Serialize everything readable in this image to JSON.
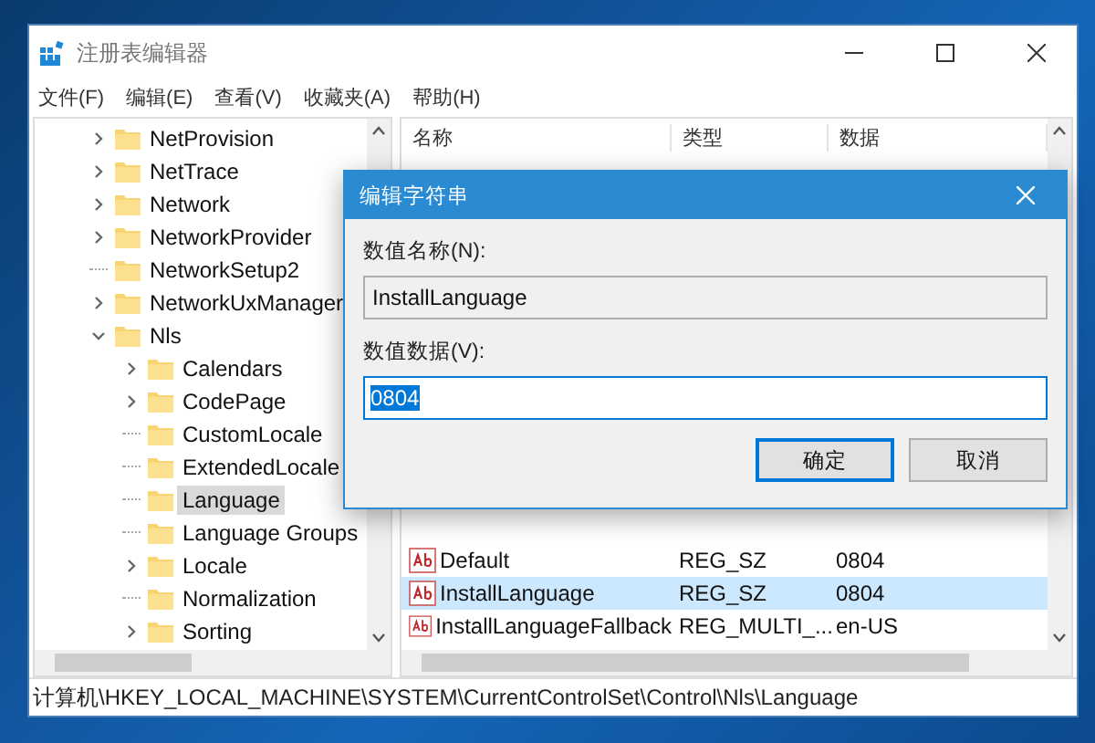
{
  "window": {
    "title": "注册表编辑器"
  },
  "menu": [
    "文件(F)",
    "编辑(E)",
    "查看(V)",
    "收藏夹(A)",
    "帮助(H)"
  ],
  "tree": [
    {
      "label": "NetProvision",
      "expanded": false,
      "selected": false
    },
    {
      "label": "NetTrace",
      "expanded": false,
      "selected": false
    },
    {
      "label": "Network",
      "expanded": false,
      "selected": false
    },
    {
      "label": "NetworkProvider",
      "expanded": false,
      "selected": false
    },
    {
      "label": "NetworkSetup2",
      "selected": false
    },
    {
      "label": "NetworkUxManager",
      "expanded": false,
      "selected": false
    },
    {
      "label": "Nls",
      "expanded": true,
      "selected": false,
      "children": [
        {
          "label": "Calendars",
          "expanded": false,
          "selected": false
        },
        {
          "label": "CodePage",
          "expanded": false,
          "selected": false
        },
        {
          "label": "CustomLocale",
          "selected": false
        },
        {
          "label": "ExtendedLocale",
          "selected": false
        },
        {
          "label": "Language",
          "selected": true
        },
        {
          "label": "Language Groups",
          "selected": false
        },
        {
          "label": "Locale",
          "expanded": false,
          "selected": false
        },
        {
          "label": "Normalization",
          "selected": false
        },
        {
          "label": "Sorting",
          "expanded": false,
          "selected": false
        }
      ]
    }
  ],
  "table": {
    "columns": [
      "名称",
      "类型",
      "数据"
    ],
    "rows": [
      {
        "name": "Default",
        "type": "REG_SZ",
        "data": "0804",
        "selected": false
      },
      {
        "name": "InstallLanguage",
        "type": "REG_SZ",
        "data": "0804",
        "selected": true
      },
      {
        "name": "InstallLanguageFallback",
        "type": "REG_MULTI_...",
        "data": "en-US",
        "selected": false
      }
    ]
  },
  "status_bar": "计算机\\HKEY_LOCAL_MACHINE\\SYSTEM\\CurrentControlSet\\Control\\Nls\\Language",
  "dialog": {
    "title": "编辑字符串",
    "name_label": "数值名称(N):",
    "name_value": "InstallLanguage",
    "data_label": "数值数据(V):",
    "data_value": "0804",
    "buttons": [
      {
        "label": "确定",
        "default": true
      },
      {
        "label": "取消",
        "default": false
      }
    ]
  }
}
